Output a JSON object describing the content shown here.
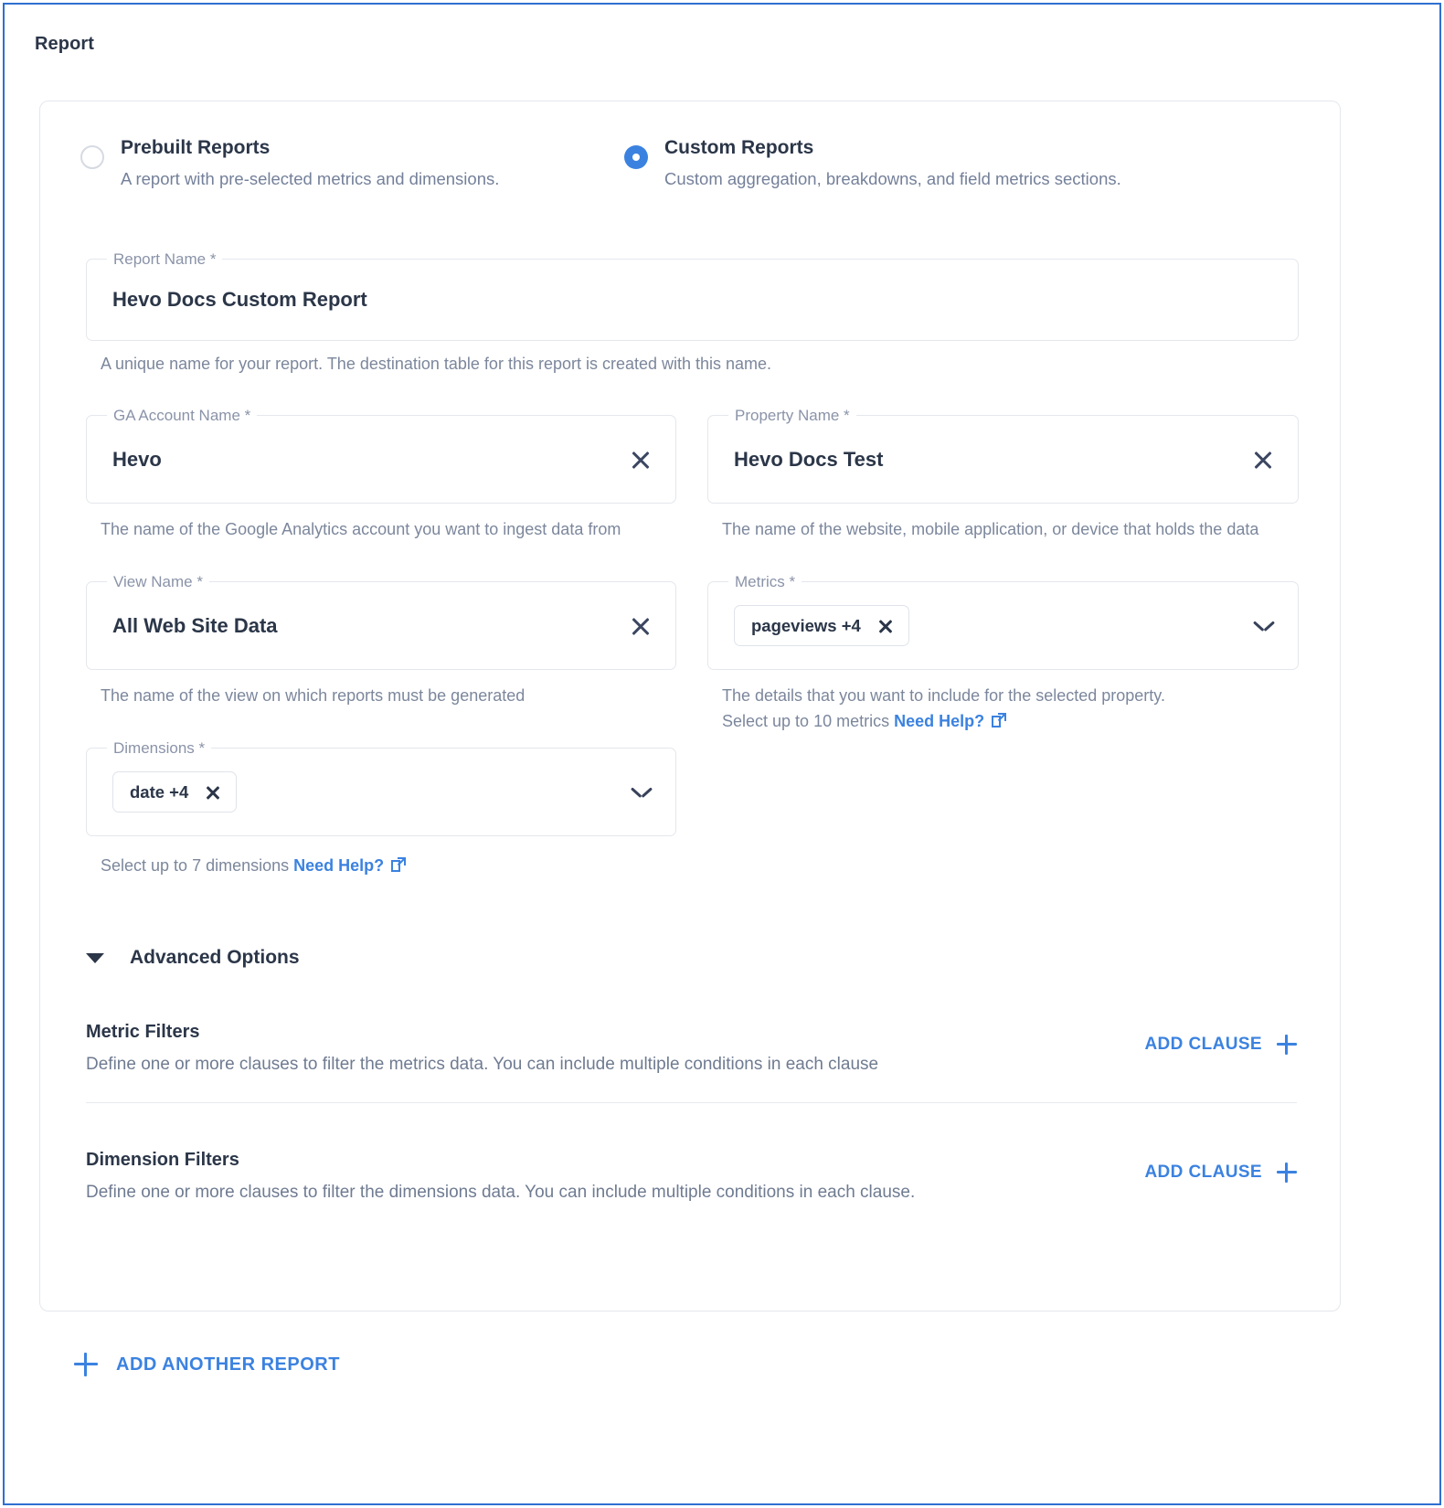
{
  "page": {
    "title": "Report",
    "accent_color": "#3b82e0",
    "text_color": "#2b3648",
    "muted_color": "#7c879c"
  },
  "report_type": {
    "prebuilt": {
      "label": "Prebuilt Reports",
      "description": "A report with pre-selected metrics and dimensions.",
      "selected": false
    },
    "custom": {
      "label": "Custom Reports",
      "description": "Custom aggregation, breakdowns, and field metrics sections.",
      "selected": true
    }
  },
  "fields": {
    "report_name": {
      "legend": "Report Name *",
      "value": "Hevo Docs Custom Report",
      "helper": "A unique name for your report. The destination table for this report is created with this name."
    },
    "ga_account_name": {
      "legend": "GA Account Name *",
      "value": "Hevo",
      "helper": "The name of the Google Analytics account you want to ingest data from",
      "clear_icon": "close-icon"
    },
    "property_name": {
      "legend": "Property Name *",
      "value": "Hevo Docs Test",
      "helper": "The name of the website, mobile application, or device that holds the data",
      "clear_icon": "close-icon"
    },
    "view_name": {
      "legend": "View Name *",
      "value": "All Web Site Data",
      "helper": "The name of the view on which reports must be generated",
      "clear_icon": "close-icon"
    },
    "metrics": {
      "legend": "Metrics *",
      "chips": [
        {
          "label": "pageviews +4"
        }
      ],
      "helper_line1": "The details that you want to include for the selected property.",
      "helper_line2_prefix": "Select up to 10 metrics ",
      "helper_link": "Need Help?",
      "dropdown_icon": "chevron-down-icon"
    },
    "dimensions": {
      "legend": "Dimensions *",
      "chips": [
        {
          "label": "date +4"
        }
      ],
      "helper_prefix": "Select up to 7 dimensions ",
      "helper_link": "Need Help?",
      "dropdown_icon": "chevron-down-icon"
    }
  },
  "advanced_options": {
    "title": "Advanced Options",
    "expanded": true,
    "metric_filters": {
      "title": "Metric Filters",
      "description": "Define one or more clauses to filter the metrics data. You can include multiple conditions in each clause",
      "add_clause_label": "ADD CLAUSE"
    },
    "dimension_filters": {
      "title": "Dimension Filters",
      "description": "Define one or more clauses to filter the dimensions data. You can include multiple conditions in each clause.",
      "add_clause_label": "ADD CLAUSE"
    }
  },
  "footer": {
    "add_another_report_label": "ADD ANOTHER REPORT"
  }
}
